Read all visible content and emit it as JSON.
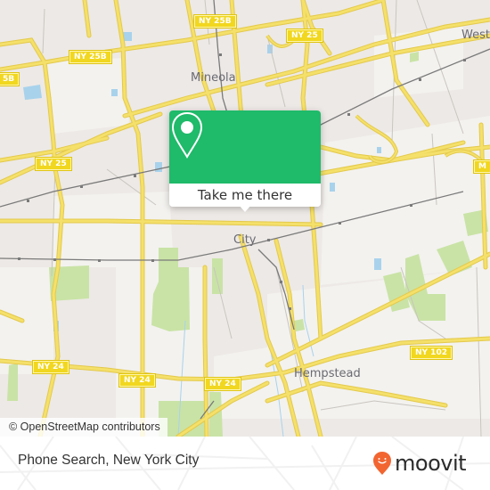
{
  "map": {
    "place_labels": [
      {
        "id": "mineola",
        "text": "Mineola"
      },
      {
        "id": "westbury",
        "text": "West"
      },
      {
        "id": "garden-city",
        "text": "City"
      },
      {
        "id": "hempstead",
        "text": "Hempstead"
      }
    ],
    "route_shields": [
      {
        "id": "ny25b-left",
        "text": "5B"
      },
      {
        "id": "ny25b-mid",
        "text": "NY 25B"
      },
      {
        "id": "ny25b-top",
        "text": "NY 25B"
      },
      {
        "id": "ny25-top",
        "text": "NY 25"
      },
      {
        "id": "ny25-left",
        "text": "NY 25"
      },
      {
        "id": "m-right",
        "text": "M"
      },
      {
        "id": "ny24-left",
        "text": "NY 24"
      },
      {
        "id": "ny24-mid",
        "text": "NY 24"
      },
      {
        "id": "ny24-right",
        "text": "NY 24"
      },
      {
        "id": "ny102",
        "text": "NY 102"
      }
    ],
    "attribution": "© OpenStreetMap contributors",
    "colors": {
      "land": "#ede9e6",
      "residential": "#f2f1ee",
      "park": "#c9e3a6",
      "water": "#a8d2ec",
      "road": "#f4e06a",
      "road_casing": "#e4c94b",
      "rail": "#7a7a7a",
      "shield": "#f1d71f"
    }
  },
  "popup": {
    "icon": "map-pin-icon",
    "button_label": "Take me there",
    "color": "#1fba6a"
  },
  "footer": {
    "title": "Phone Search, New York City",
    "brand": {
      "icon": "moovit-smile-pin-icon",
      "name": "moovit",
      "color": "#f26531"
    }
  }
}
